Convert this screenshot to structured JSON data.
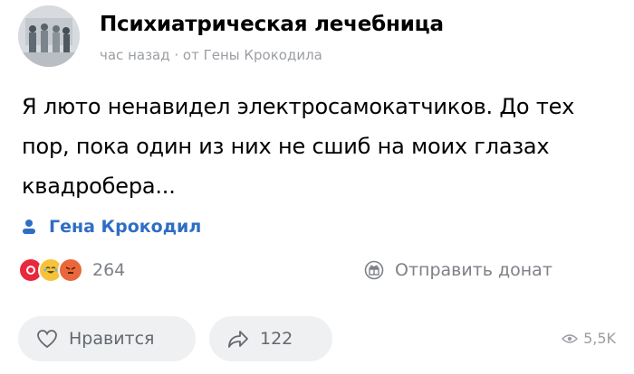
{
  "post": {
    "community_name": "Психиатрическая лечебница",
    "meta": "час назад · от Гены Крокодила",
    "text": "Я люто ненавидел электросамокатчиков. До тех пор, пока один из них не сшиб на моих глазах квадробера...",
    "author": "Гена Крокодил",
    "reactions_count": "264",
    "donate_label": "Отправить донат",
    "like_label": "Нравится",
    "share_count": "122",
    "views_count": "5,5K"
  },
  "icons": {
    "author": "person-icon",
    "donate": "gift-icon",
    "like": "heart-icon",
    "share": "share-arrow-icon",
    "views": "eye-icon",
    "reactions": [
      "heart-reaction-icon",
      "laugh-reaction-icon",
      "angry-reaction-icon"
    ]
  },
  "colors": {
    "accent": "#2f6ec4",
    "muted": "#7d8187",
    "heart": "#e8283c",
    "laugh": "#f5c23a",
    "angry": "#e9673a"
  }
}
